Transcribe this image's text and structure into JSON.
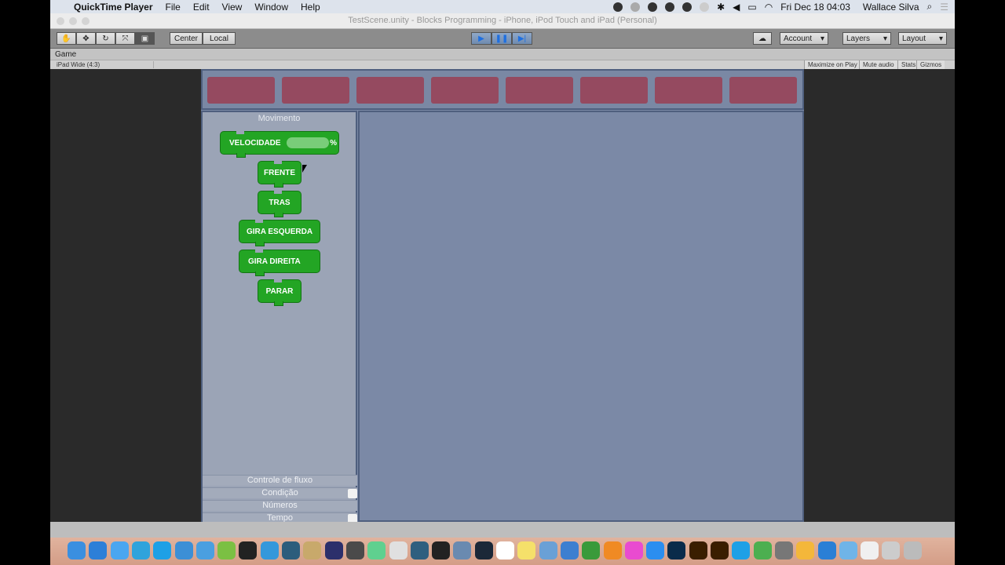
{
  "menubar": {
    "app": "QuickTime Player",
    "items": [
      "File",
      "Edit",
      "View",
      "Window",
      "Help"
    ],
    "clock": "Fri Dec 18  04:03",
    "user": "Wallace Silva"
  },
  "window": {
    "title": "TestScene.unity - Blocks Programming - iPhone, iPod Touch and iPad (Personal)"
  },
  "toolbar": {
    "center": "Center",
    "local": "Local",
    "account": "Account",
    "layers": "Layers",
    "layout": "Layout"
  },
  "game": {
    "tab": "Game",
    "aspect": "iPad Wide (4:3)",
    "maximize": "Maximize on Play",
    "mute": "Mute audio",
    "stats": "Stats",
    "gizmos": "Gizmos"
  },
  "palette": {
    "title": "Movimento",
    "blocks": [
      "VELOCIDADE",
      "FRENTE",
      "TRAS",
      "GIRA ESQUERDA",
      "GIRA DIREITA",
      "PARAR"
    ],
    "percent": "%",
    "categories": [
      "Controle de fluxo",
      "Condição",
      "Números",
      "Tempo"
    ]
  },
  "colors": {
    "block": "#23a524",
    "slot": "#954a60",
    "workspace": "#7b89a6"
  },
  "dock": [
    "finder",
    "safari",
    "messages",
    "telegram",
    "skype",
    "xcode",
    "simulator",
    "android-studio",
    "app-13",
    "xamarin",
    "mysql-workbench",
    "app-box",
    "eclipse",
    "sublime-text",
    "atom",
    "slack",
    "sourcetree",
    "unity",
    "app-gear",
    "steam",
    "calendar",
    "notes",
    "preview",
    "keynote",
    "numbers",
    "ibooks",
    "itunes",
    "app-store",
    "photoshop",
    "illustrator",
    "illustrator-2",
    "skype-2",
    "utorrent",
    "system-preferences",
    "sketch",
    "quicktime",
    "folder",
    "document",
    "preview-2",
    "trash"
  ]
}
